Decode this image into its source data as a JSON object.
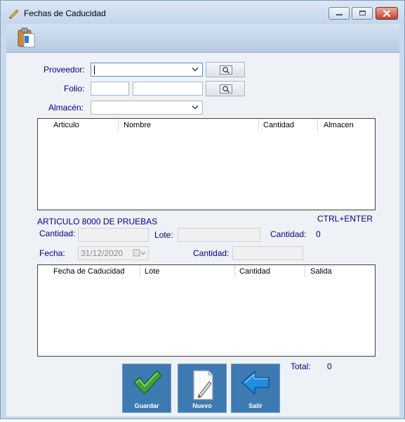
{
  "window": {
    "title": "Fechas de Caducidad"
  },
  "icons": {
    "app": "pencil-icon",
    "toolbar": "clipboard-icon",
    "search": "magnifier-icon",
    "dropdown": "chevron-down-icon",
    "guardar": "checkmark-icon",
    "nuevo": "new-document-icon",
    "salir": "back-arrow-icon"
  },
  "form": {
    "proveedor_label": "Proveedor:",
    "proveedor_value": "",
    "folio_label": "Folio:",
    "folio_value_1": "",
    "folio_value_2": "",
    "almacen_label": "Almacén:",
    "almacen_value": ""
  },
  "articles_table": {
    "columns": [
      "Articulo",
      "Nombre",
      "Cantidad",
      "Almacen"
    ],
    "rows": []
  },
  "detail": {
    "article_title": "ARTICULO 8000 DE PRUEBAS",
    "shortcut_hint": "CTRL+ENTER",
    "cantidad_label": "Cantidad:",
    "cantidad_value": "",
    "lote_label": "Lote:",
    "lote_value": "",
    "cantidad_total_label": "Cantidad:",
    "cantidad_total_value": "0",
    "fecha_label": "Fecha:",
    "fecha_value": "31/12/2020",
    "cantidad2_label": "Cantidad:",
    "cantidad2_value": ""
  },
  "lots_table": {
    "columns": [
      "Fecha de Caducidad",
      "Lote",
      "Cantidad",
      "Salida"
    ],
    "rows": []
  },
  "summary": {
    "total_label": "Total:",
    "total_value": "0"
  },
  "actions": {
    "guardar": "Guardar",
    "nuevo": "Nuevo",
    "salir": "Salir"
  },
  "colors": {
    "label_text": "#000080",
    "button_bg": "#3d7ab2",
    "check_green": "#3fa33a",
    "arrow_blue": "#1f8de0",
    "close_red": "#c4432b"
  }
}
